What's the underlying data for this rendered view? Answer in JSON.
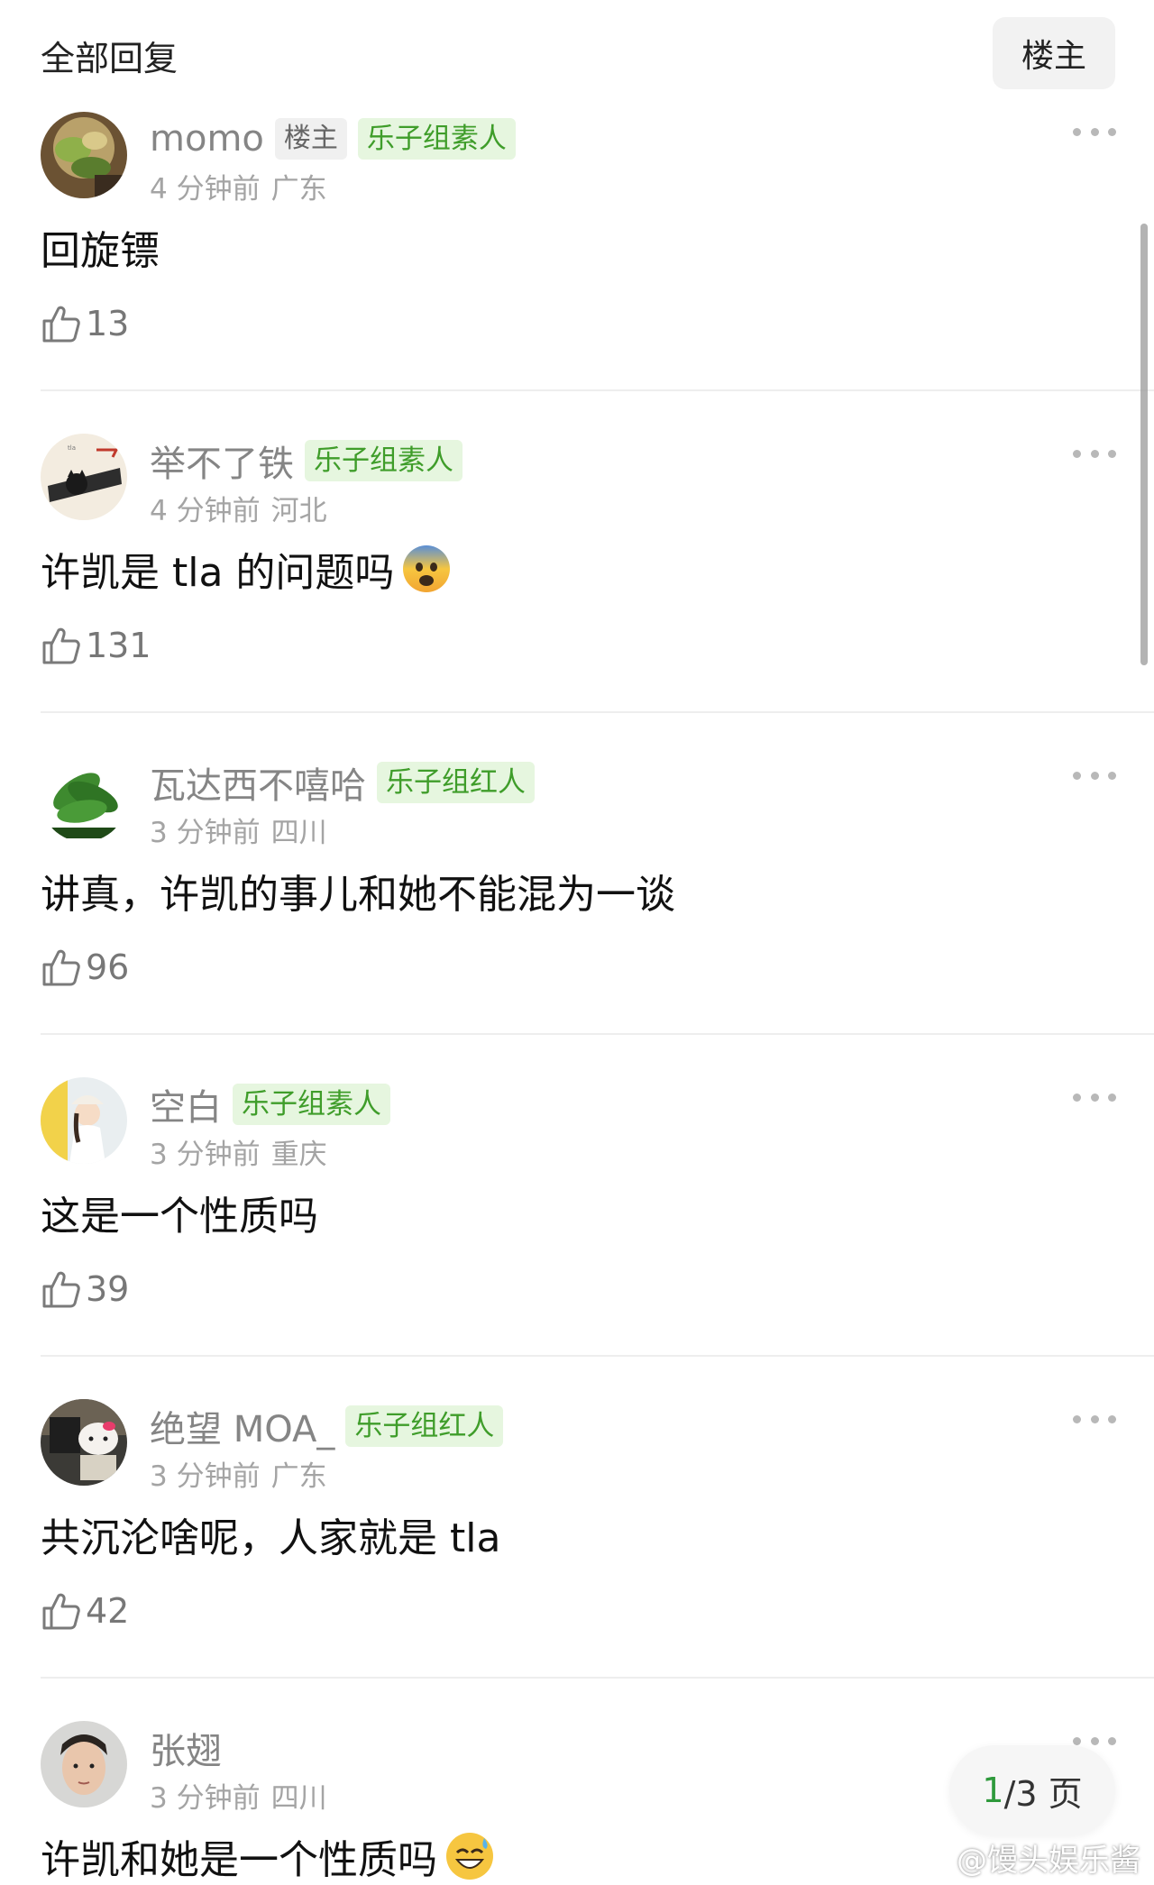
{
  "header": {
    "title": "全部回复",
    "filter_button": "楼主"
  },
  "comments": [
    {
      "username": "momo",
      "op_tag": "楼主",
      "group_tag": "乐子组素人",
      "time": "4 分钟前",
      "location": "广东",
      "text": "回旋镖",
      "emoji": "",
      "likes": "13"
    },
    {
      "username": "举不了铁",
      "op_tag": "",
      "group_tag": "乐子组素人",
      "time": "4 分钟前",
      "location": "河北",
      "text": "许凯是 tla 的问题吗",
      "emoji": "fearful-face",
      "likes": "131"
    },
    {
      "username": "瓦达西不嘻哈",
      "op_tag": "",
      "group_tag": "乐子组红人",
      "time": "3 分钟前",
      "location": "四川",
      "text": "讲真，许凯的事儿和她不能混为一谈",
      "emoji": "",
      "likes": "96"
    },
    {
      "username": "空白",
      "op_tag": "",
      "group_tag": "乐子组素人",
      "time": "3 分钟前",
      "location": "重庆",
      "text": "这是一个性质吗",
      "emoji": "",
      "likes": "39"
    },
    {
      "username": "绝望 MOA_",
      "op_tag": "",
      "group_tag": "乐子组红人",
      "time": "3 分钟前",
      "location": "广东",
      "text": "共沉沦啥呢，人家就是 tla",
      "emoji": "",
      "likes": "42"
    },
    {
      "username": "张翅",
      "op_tag": "",
      "group_tag": "",
      "time": "3 分钟前",
      "location": "四川",
      "text": "许凯和她是一个性质吗",
      "emoji": "sweat-smile-face",
      "likes": ""
    }
  ],
  "pager": {
    "current": "1",
    "total": "/3 页"
  },
  "watermark": {
    "text": "@馒头娱乐酱",
    "icon": "weibo-logo-icon"
  },
  "colors": {
    "tag_green": "#3f9d2a",
    "tag_bg": "#e6f6df",
    "page_current": "#2f9a3c"
  }
}
